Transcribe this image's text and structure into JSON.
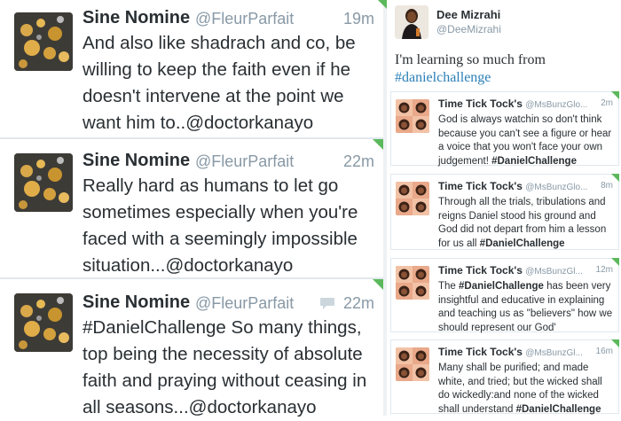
{
  "left_tweets": [
    {
      "name": "Sine Nomine",
      "handle": "@FleurParfait",
      "time": "19m",
      "text": "And also like shadrach and co, be willing to keep the faith even if he doesn't intervene at the point we want him to..@doctorkanayo"
    },
    {
      "name": "Sine Nomine",
      "handle": "@FleurParfait",
      "time": "22m",
      "text": "Really hard as humans to let go sometimes especially when you're faced with a seemingly impossible situation...@doctorkanayo"
    },
    {
      "name": "Sine Nomine",
      "handle": "@FleurParfait",
      "time": "22m",
      "text": "#DanielChallenge So many things, top being the necessity of absolute faith and praying without ceasing in all seasons...@doctorkanayo",
      "reply_icon": "speech-bubble-icon"
    }
  ],
  "main_tweet": {
    "name": "Dee Mizrahi",
    "handle": "@DeeMizrahi",
    "text": "I'm learning so much from",
    "hashtag": "#danielchallenge",
    "hashtag_color": "#2a7fb8"
  },
  "right_tweets": [
    {
      "name": "Time Tick Tock's",
      "handle": "@MsBunzGlo...",
      "time": "2m",
      "text": "God is always watchin so don't think because you can't see a figure or hear a voice that you won't face your own judgement!",
      "tag": "#DanielChallenge"
    },
    {
      "name": "Time Tick Tock's",
      "handle": "@MsBunzGlo...",
      "time": "8m",
      "text": "Through all the trials, tribulations and reigns Daniel stood his ground and God did not depart from him a lesson for us all",
      "tag": "#DanielChallenge"
    },
    {
      "name": "Time Tick Tock's",
      "handle": "@MsBunzGl...",
      "time": "12m",
      "pre": "The",
      "tag": "#DanielChallenge",
      "text": "has been very insightful and educative in explaining and teaching us as \"believers\" how we should represent our God'"
    },
    {
      "name": "Time Tick Tock's",
      "handle": "@MsBunzGl...",
      "time": "16m",
      "text": "Many shall be purified; and made white, and tried; but the wicked shall do wickedly:and none of the wicked shall understand",
      "tag": "#DanielChallenge"
    }
  ],
  "colors": {
    "corner_accent": "#5cb85c",
    "muted": "#8899a6",
    "text": "#292f33"
  }
}
